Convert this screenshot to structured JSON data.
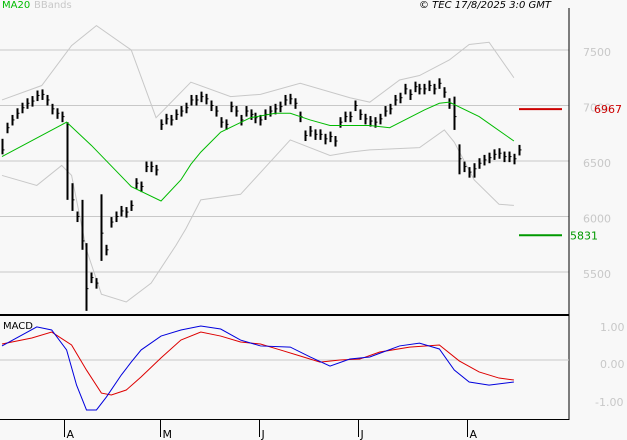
{
  "header": {
    "legend_ma": "MA20",
    "legend_bbands": "BBands",
    "copyright": "© TEC 17/8/2025 3:0 GMT"
  },
  "colors": {
    "ma": "#00bb00",
    "bands": "#c8c8c8",
    "macd": "#0000dd",
    "signal": "#dd0000",
    "resistance": "#cc0000",
    "support": "#009900"
  },
  "chart_data": [
    {
      "type": "bar",
      "title": "Price (OHLC) with MA20 and Bollinger Bands",
      "yticks": [
        7500,
        7000,
        6500,
        6000,
        5500
      ],
      "ytick_labels": [
        "7500",
        "7000",
        "6500",
        "6000",
        "5500"
      ],
      "xtick_labels": [
        "A",
        "M",
        "J",
        "J",
        "A"
      ],
      "xtick_index": [
        12.5,
        31.8,
        51.7,
        71.6,
        93.5
      ],
      "ylim": [
        5150,
        7900
      ],
      "closes": [
        6600,
        6800,
        6870,
        6930,
        6980,
        7020,
        7040,
        7090,
        7100,
        7050,
        6970,
        6930,
        6900,
        6830,
        6150,
        6000,
        5780,
        5350,
        5450,
        5400,
        5850,
        5700,
        5950,
        6000,
        6050,
        6040,
        6100,
        6300,
        6270,
        6450,
        6450,
        6420,
        6830,
        6880,
        6870,
        6920,
        6950,
        6980,
        7050,
        7050,
        7080,
        7060,
        7000,
        6950,
        6850,
        6830,
        6990,
        6950,
        6870,
        6950,
        6920,
        6890,
        6870,
        6920,
        6950,
        6970,
        6990,
        7050,
        7060,
        7020,
        6900,
        6730,
        6770,
        6740,
        6740,
        6700,
        6720,
        6680,
        6850,
        6900,
        6900,
        7000,
        6920,
        6880,
        6860,
        6850,
        6880,
        6950,
        6970,
        7050,
        7070,
        7150,
        7100,
        7170,
        7150,
        7150,
        7180,
        7150,
        7200,
        7120,
        7020,
        6900,
        6520,
        6450,
        6400,
        6430,
        6480,
        6510,
        6530,
        6560,
        6570,
        6540,
        6540,
        6520,
        6600
      ],
      "wide_bars": {
        "0": [
          6560,
          6700
        ],
        "13": [
          6150,
          6850
        ],
        "14": [
          6050,
          6300
        ],
        "16": [
          5700,
          6150
        ],
        "17": [
          5150,
          5760
        ],
        "20": [
          5600,
          6200
        ],
        "91": [
          6780,
          7080
        ],
        "92": [
          6380,
          6650
        ],
        "95": [
          6350,
          6480
        ]
      },
      "ma20": [
        [
          0,
          6540
        ],
        [
          13,
          6850
        ],
        [
          18,
          6640
        ],
        [
          26,
          6270
        ],
        [
          32,
          6140
        ],
        [
          36,
          6330
        ],
        [
          38,
          6470
        ],
        [
          40,
          6580
        ],
        [
          44,
          6760
        ],
        [
          50,
          6890
        ],
        [
          55,
          6930
        ],
        [
          58,
          6930
        ],
        [
          62,
          6870
        ],
        [
          66,
          6820
        ],
        [
          74,
          6820
        ],
        [
          78,
          6800
        ],
        [
          85,
          6960
        ],
        [
          88,
          7020
        ],
        [
          90,
          7030
        ],
        [
          96,
          6900
        ],
        [
          103,
          6680
        ]
      ],
      "bband_upper": [
        [
          0,
          7050
        ],
        [
          8,
          7180
        ],
        [
          14,
          7540
        ],
        [
          19,
          7720
        ],
        [
          26,
          7500
        ],
        [
          31,
          6890
        ],
        [
          38,
          7210
        ],
        [
          46,
          7080
        ],
        [
          52,
          7100
        ],
        [
          60,
          7200
        ],
        [
          70,
          7070
        ],
        [
          74,
          7030
        ],
        [
          80,
          7230
        ],
        [
          84,
          7270
        ],
        [
          90,
          7410
        ],
        [
          94,
          7550
        ],
        [
          98,
          7570
        ],
        [
          103,
          7250
        ]
      ],
      "bband_lower": [
        [
          0,
          6370
        ],
        [
          7,
          6280
        ],
        [
          12,
          6460
        ],
        [
          14,
          6370
        ],
        [
          17,
          5700
        ],
        [
          20,
          5300
        ],
        [
          25,
          5230
        ],
        [
          30,
          5400
        ],
        [
          35,
          5740
        ],
        [
          37,
          5890
        ],
        [
          40,
          6150
        ],
        [
          48,
          6200
        ],
        [
          58,
          6690
        ],
        [
          66,
          6550
        ],
        [
          70,
          6580
        ],
        [
          74,
          6600
        ],
        [
          84,
          6620
        ],
        [
          89,
          6780
        ],
        [
          91,
          6670
        ],
        [
          95,
          6330
        ],
        [
          100,
          6110
        ],
        [
          103,
          6100
        ]
      ],
      "levels": [
        {
          "label": "6967",
          "value": 6967,
          "kind": "resistance"
        },
        {
          "label": "5831",
          "value": 5831,
          "kind": "support"
        }
      ]
    },
    {
      "type": "line",
      "title": "MACD",
      "yticks": [
        1,
        0,
        -1
      ],
      "ytick_labels": [
        "1.00",
        "0.00",
        "-1.00"
      ],
      "ylim": [
        -3,
        2.4
      ],
      "series": [
        {
          "name": "MACD",
          "points": [
            [
              0,
              0.74
            ],
            [
              7,
              1.74
            ],
            [
              10,
              1.58
            ],
            [
              13,
              0.53
            ],
            [
              15,
              -1.32
            ],
            [
              17,
              -2.63
            ],
            [
              19,
              -2.63
            ],
            [
              21,
              -1.95
            ],
            [
              24,
              -0.79
            ],
            [
              26,
              -0.11
            ],
            [
              28,
              0.53
            ],
            [
              32,
              1.26
            ],
            [
              36,
              1.58
            ],
            [
              40,
              1.79
            ],
            [
              44,
              1.63
            ],
            [
              48,
              1.05
            ],
            [
              52,
              0.74
            ],
            [
              58,
              0.68
            ],
            [
              62,
              0.16
            ],
            [
              66,
              -0.32
            ],
            [
              70,
              0.05
            ],
            [
              74,
              0.16
            ],
            [
              80,
              0.74
            ],
            [
              84,
              0.89
            ],
            [
              88,
              0.58
            ],
            [
              91,
              -0.53
            ],
            [
              94,
              -1.16
            ],
            [
              98,
              -1.32
            ],
            [
              103,
              -1.16
            ]
          ]
        },
        {
          "name": "Signal",
          "points": [
            [
              0,
              0.84
            ],
            [
              6,
              1.16
            ],
            [
              10,
              1.47
            ],
            [
              14,
              0.79
            ],
            [
              17,
              -0.53
            ],
            [
              20,
              -1.74
            ],
            [
              22,
              -1.84
            ],
            [
              25,
              -1.58
            ],
            [
              28,
              -0.89
            ],
            [
              32,
              0.11
            ],
            [
              36,
              1.05
            ],
            [
              40,
              1.47
            ],
            [
              44,
              1.26
            ],
            [
              48,
              0.95
            ],
            [
              52,
              0.84
            ],
            [
              56,
              0.53
            ],
            [
              60,
              0.21
            ],
            [
              64,
              -0.11
            ],
            [
              68,
              0
            ],
            [
              72,
              0.05
            ],
            [
              76,
              0.42
            ],
            [
              82,
              0.68
            ],
            [
              88,
              0.79
            ],
            [
              92,
              -0.05
            ],
            [
              96,
              -0.63
            ],
            [
              100,
              -0.95
            ],
            [
              103,
              -1.05
            ]
          ]
        }
      ]
    }
  ]
}
